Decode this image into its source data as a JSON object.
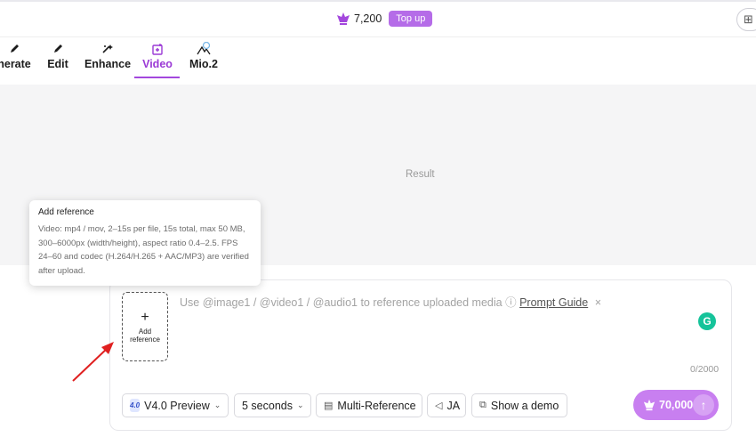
{
  "topbar": {
    "credits_amount": "7,200",
    "topup_label": "Top up",
    "coin_icon": "crown-coin-icon",
    "corner_icon": "gift-icon"
  },
  "tabs": [
    {
      "label": "nerate",
      "icon": "pencil-icon"
    },
    {
      "label": "Edit",
      "icon": "pencil-icon"
    },
    {
      "label": "Enhance",
      "icon": "sparkle-wand-icon"
    },
    {
      "label": "Video",
      "icon": "video-add-icon",
      "active": true
    },
    {
      "label": "Mio.2",
      "icon": "mio-icon"
    }
  ],
  "result": {
    "label": "Result"
  },
  "composer": {
    "add_reference_plus": "+",
    "add_reference_label": "Add reference",
    "placeholder_prefix": "Use @image1 / @video1 / @audio1 to reference uploaded media",
    "help_icon": "?",
    "prompt_guide": "Prompt Guide",
    "close_symbol": "×",
    "counter": "0/2000",
    "grammarly_letter": "G"
  },
  "controls": {
    "model_badge": "4.0",
    "model": "V4.0 Preview",
    "duration": "5 seconds",
    "multi_reference": "Multi-Reference",
    "audio_lang": "JA",
    "show_demo": "Show a demo",
    "generate_cost": "70,000"
  },
  "tooltip": {
    "title": "Add reference",
    "body": "Video: mp4 / mov, 2–15s per file, 15s total, max 50 MB, 300–6000px (width/height), aspect ratio 0.4–2.5. FPS 24–60 and codec (H.264/H.265 + AAC/MP3) are verified after upload."
  },
  "colors": {
    "accent": "#a347dd",
    "topup_bg": "#b56ce8",
    "generate_bg": "#c87ff0",
    "annotation_arrow": "#e02020"
  }
}
